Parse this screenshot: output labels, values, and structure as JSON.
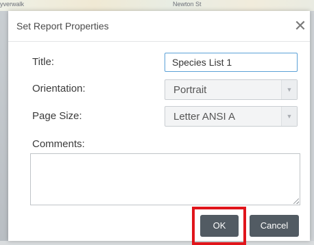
{
  "background": {
    "labels": [
      "yverwalk",
      "Newton St"
    ]
  },
  "dialog": {
    "title": "Set Report Properties",
    "close_glyph": "✕",
    "fields": {
      "title_label": "Title:",
      "title_value": "Species List 1",
      "orientation_label": "Orientation:",
      "orientation_value": "Portrait",
      "page_size_label": "Page Size:",
      "page_size_value": "Letter ANSI A",
      "comments_label": "Comments:",
      "comments_value": ""
    },
    "buttons": {
      "ok": "OK",
      "cancel": "Cancel"
    }
  },
  "colors": {
    "button_bg": "#525b63",
    "highlight": "#e0151b",
    "input_focus_border": "#5aa0d6"
  },
  "icons": {
    "close": "close-icon",
    "dropdown": "chevron-down-icon",
    "resize": "resize-grip-icon"
  }
}
